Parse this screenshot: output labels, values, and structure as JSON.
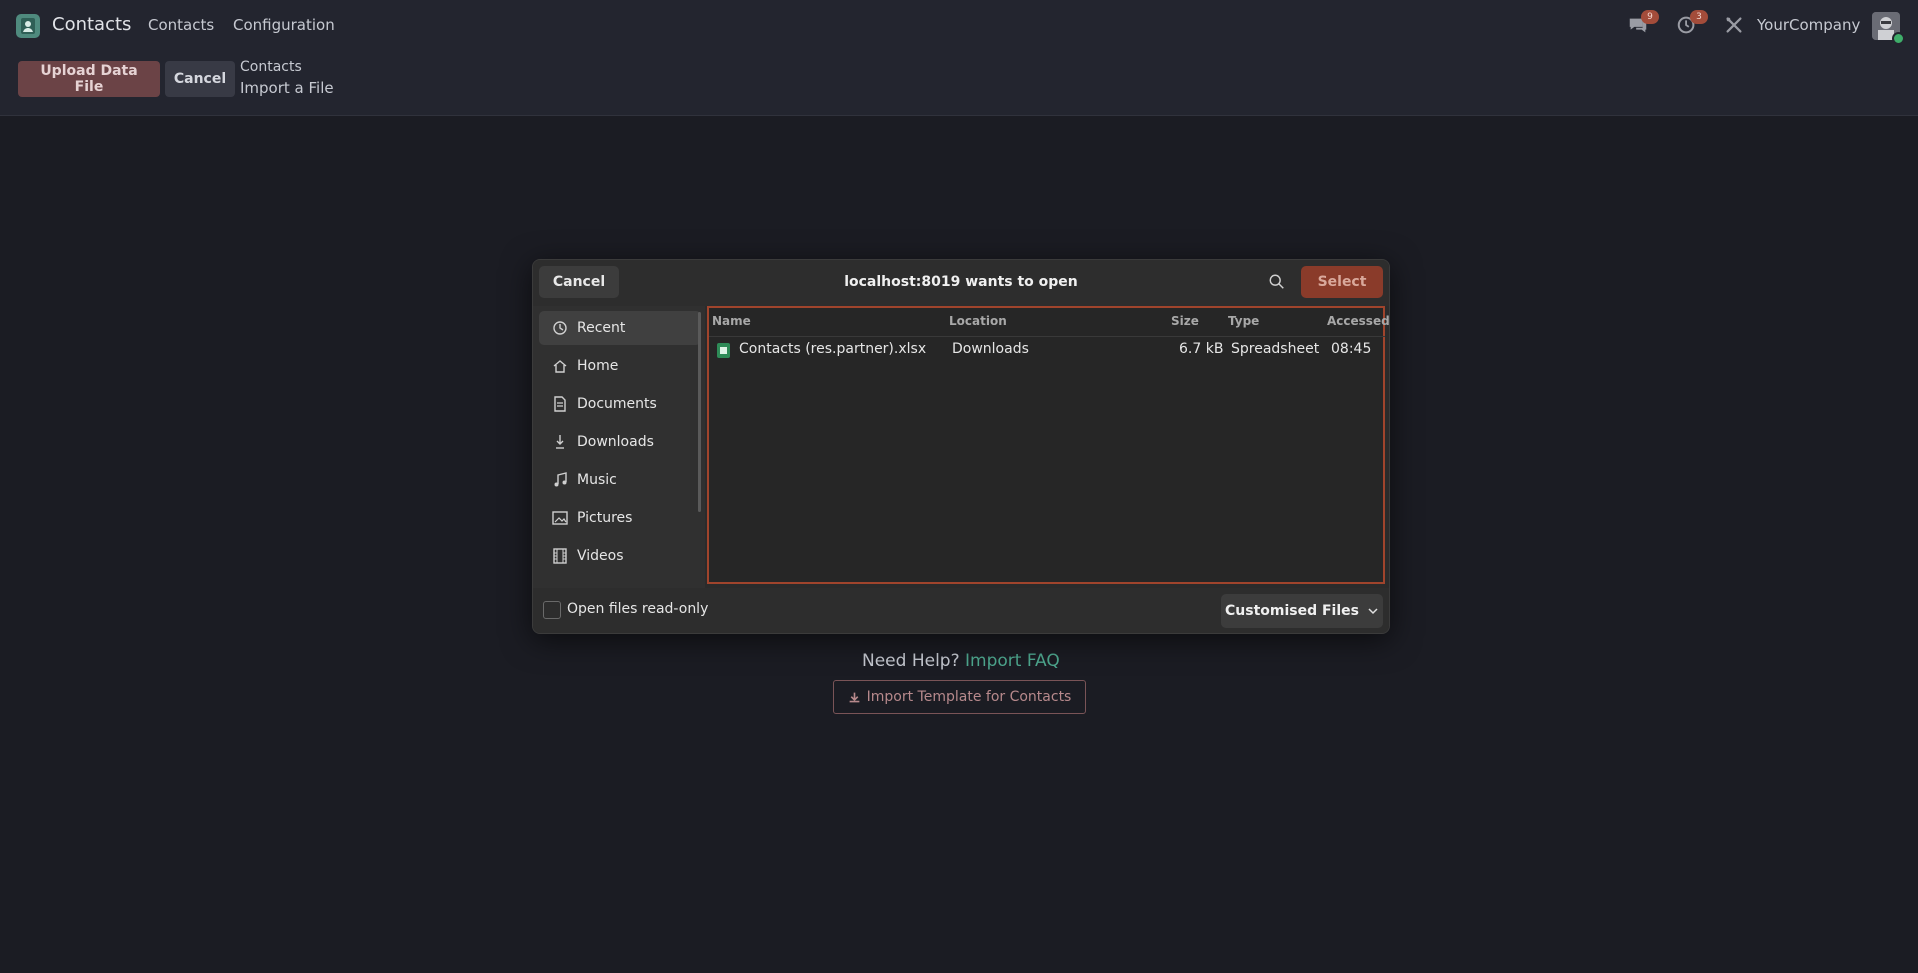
{
  "navbar": {
    "app_name": "Contacts",
    "menu": [
      "Contacts",
      "Configuration"
    ],
    "messages_badge": "9",
    "activities_badge": "3",
    "company": "YourCompany"
  },
  "control_panel": {
    "upload_label": "Upload Data File",
    "cancel_label": "Cancel",
    "breadcrumb": [
      "Contacts",
      "Import a File"
    ]
  },
  "help": {
    "prefix": "Need Help?",
    "link": "Import FAQ",
    "template_label": "Import Template for Contacts"
  },
  "dialog": {
    "cancel_label": "Cancel",
    "title": "localhost:8019 wants to open",
    "select_label": "Select",
    "sidebar": [
      "Recent",
      "Home",
      "Documents",
      "Downloads",
      "Music",
      "Pictures",
      "Videos"
    ],
    "columns": {
      "name": "Name",
      "location": "Location",
      "size": "Size",
      "type": "Type",
      "accessed": "Accessed"
    },
    "files": [
      {
        "name": "Contacts (res.partner).xlsx",
        "location": "Downloads",
        "size": "6.7 kB",
        "type": "Spreadsheet",
        "accessed": "08:45"
      }
    ],
    "readonly_label": "Open files read-only",
    "filter_label": "Customised Files"
  },
  "colors": {
    "accent": "#a0442c",
    "upload_button": "#6b4346",
    "link": "#4ea88f"
  }
}
